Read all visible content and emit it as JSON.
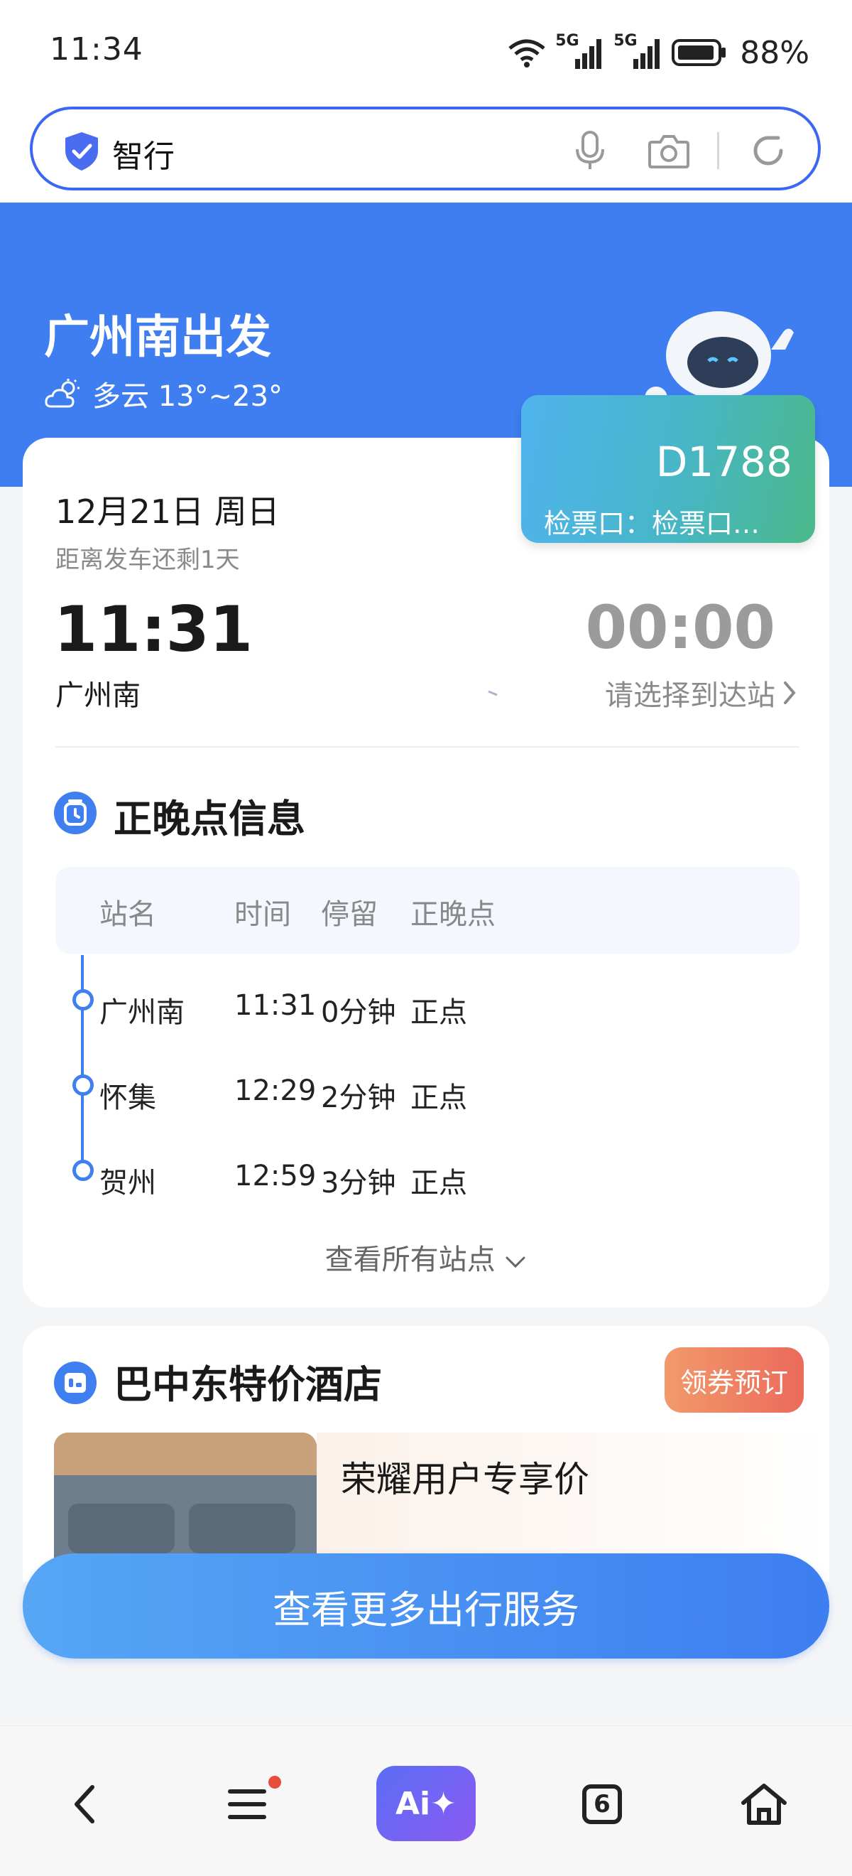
{
  "status_bar": {
    "time": "11:34",
    "network1": "5G",
    "network2": "5G",
    "battery": "88%"
  },
  "search": {
    "value": "智行"
  },
  "hero": {
    "title": "广州南出发",
    "weather": "多云 13°~23°"
  },
  "train": {
    "number": "D1788",
    "gate": "检票口：检票口…"
  },
  "trip": {
    "date": "12月21日 周日",
    "countdown": "距离发车还剩1天",
    "dep_time": "11:31",
    "dep_station": "广州南",
    "arr_time": "00:00",
    "arr_select": "请选择到达站"
  },
  "punctuality": {
    "title": "正晚点信息",
    "headers": [
      "站名",
      "时间",
      "停留",
      "正晚点"
    ],
    "rows": [
      {
        "station": "广州南",
        "time": "11:31",
        "stay": "0分钟",
        "status": "正点"
      },
      {
        "station": "怀集",
        "time": "12:29",
        "stay": "2分钟",
        "status": "正点"
      },
      {
        "station": "贺州",
        "time": "12:59",
        "stay": "3分钟",
        "status": "正点"
      }
    ],
    "view_all": "查看所有站点"
  },
  "hotel": {
    "title": "巴中东特价酒店",
    "coupon_button": "领券预订",
    "promo": "荣耀用户专享价"
  },
  "more_button": "查看更多出行服务",
  "nav": {
    "ai_label": "Ai✦",
    "tabs_count": "6"
  },
  "colors": {
    "accent": "#3e7ef0",
    "train_badge": "#47b6c5",
    "coupon": "#ec6a5c"
  }
}
